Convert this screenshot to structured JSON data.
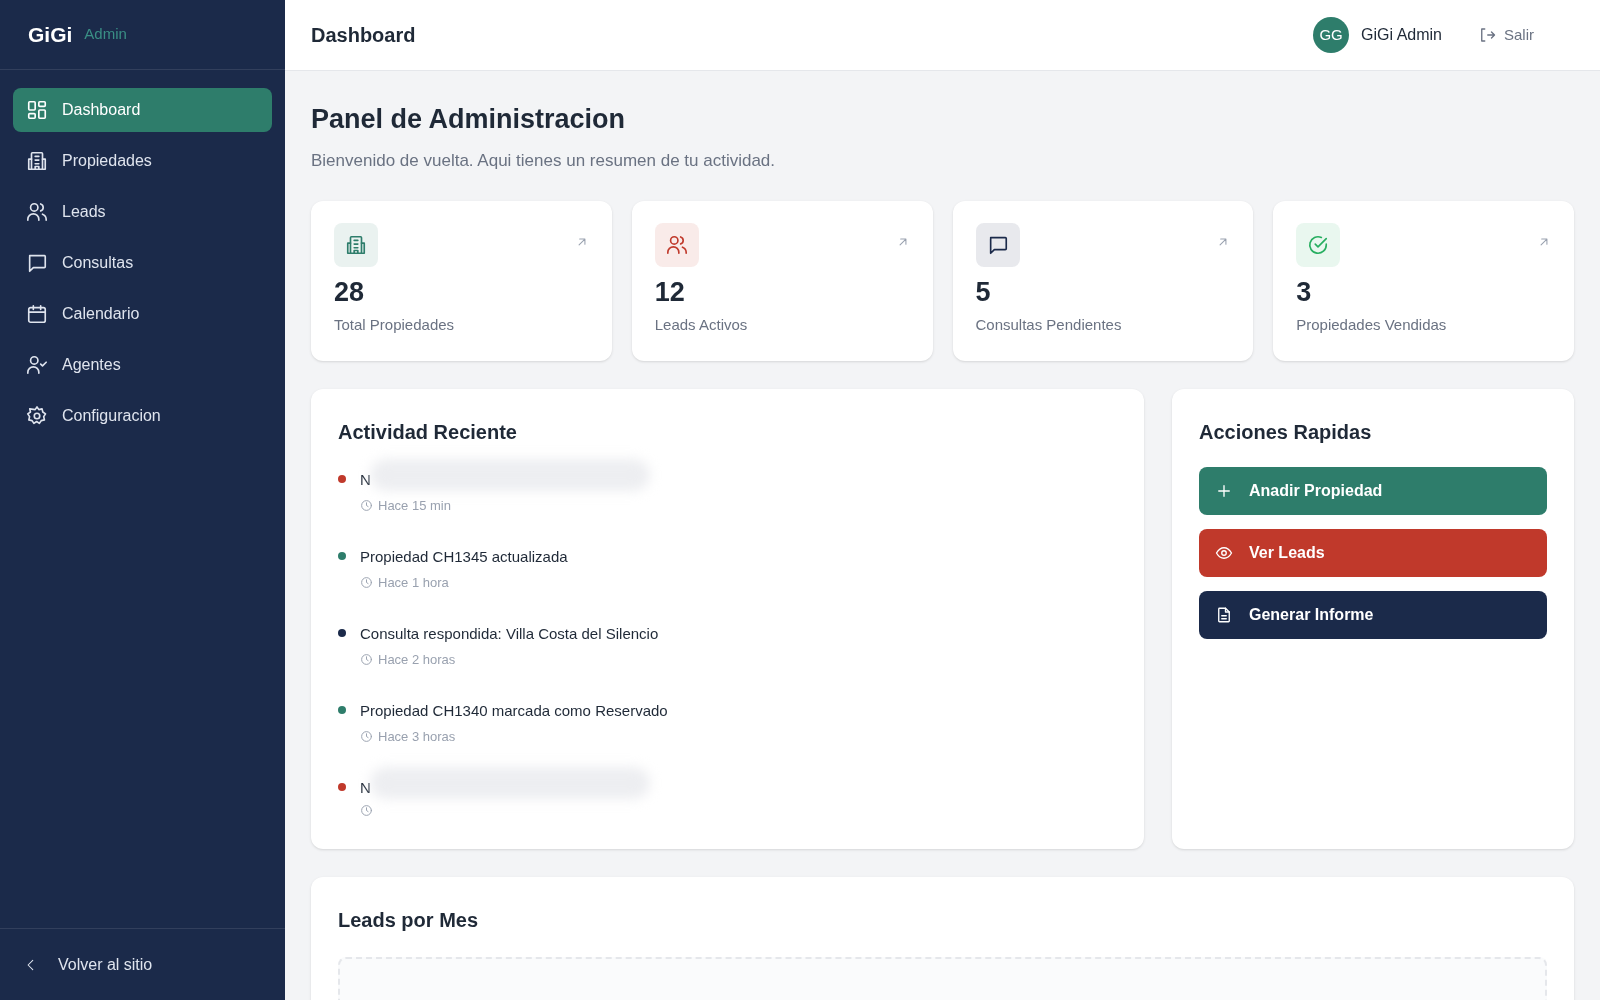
{
  "sidebar": {
    "logo": "GiGi",
    "logo_tag": "Admin",
    "items": [
      {
        "label": "Dashboard",
        "selected": true
      },
      {
        "label": "Propiedades",
        "selected": false
      },
      {
        "label": "Leads",
        "selected": false
      },
      {
        "label": "Consultas",
        "selected": false
      },
      {
        "label": "Calendario",
        "selected": false
      },
      {
        "label": "Agentes",
        "selected": false
      },
      {
        "label": "Configuracion",
        "selected": false
      }
    ],
    "footer_link": "Volver al sitio"
  },
  "header": {
    "title": "Dashboard",
    "avatar": "GG",
    "user": "GiGi Admin",
    "logout": "Salir"
  },
  "page": {
    "title": "Panel de Administracion",
    "subtitle": "Bienvenido de vuelta. Aqui tienes un resumen de tu actividad."
  },
  "stats": [
    {
      "value": "28",
      "label": "Total Propiedades",
      "color": "#2e7d6b"
    },
    {
      "value": "12",
      "label": "Leads Activos",
      "color": "#c0392b"
    },
    {
      "value": "5",
      "label": "Consultas Pendientes",
      "color": "#1b2a4a"
    },
    {
      "value": "3",
      "label": "Propiedades Vendidas",
      "color": "#27ae60"
    }
  ],
  "activity": {
    "title": "Actividad Reciente",
    "items": [
      {
        "text": "N",
        "time": "Hace 15 min",
        "color": "#c0392b",
        "blurred": true
      },
      {
        "text": "Propiedad CH1345 actualizada",
        "time": "Hace 1 hora",
        "color": "#2e7d6b",
        "blurred": false
      },
      {
        "text": "Consulta respondida: Villa Costa del Silencio",
        "time": "Hace 2 horas",
        "color": "#1b2a4a",
        "blurred": false
      },
      {
        "text": "Propiedad CH1340 marcada como Reservado",
        "time": "Hace 3 horas",
        "color": "#2e7d6b",
        "blurred": false
      },
      {
        "text": "N",
        "color": "#c0392b",
        "blurred": true
      }
    ]
  },
  "quick_actions": {
    "title": "Acciones Rapidas",
    "buttons": [
      {
        "label": "Anadir Propiedad",
        "color": "#2e7d6b"
      },
      {
        "label": "Ver Leads",
        "color": "#c0392b"
      },
      {
        "label": "Generar Informe",
        "color": "#1b2a4a"
      }
    ]
  },
  "leads_chart": {
    "title": "Leads por Mes"
  }
}
